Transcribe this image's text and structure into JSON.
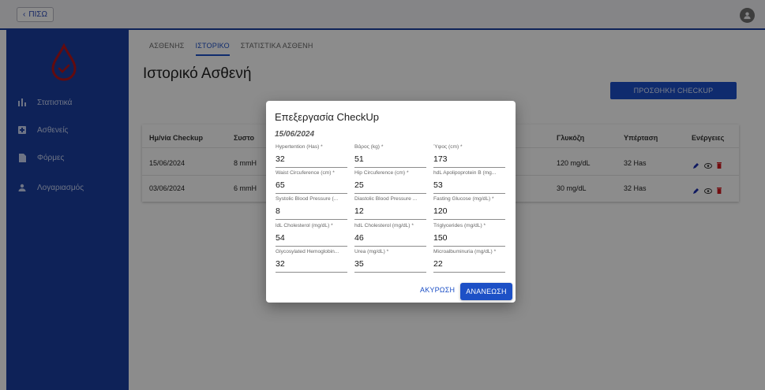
{
  "topbar": {
    "back_label": "ΠΙΣΩ"
  },
  "sidebar": {
    "items": [
      {
        "label": "Στατιστικά",
        "icon": "bar-chart-icon"
      },
      {
        "label": "Ασθενείς",
        "icon": "plus-box-icon"
      },
      {
        "label": "Φόρμες",
        "icon": "document-icon"
      },
      {
        "label": "Λογαριασμός",
        "icon": "person-icon"
      }
    ]
  },
  "tabs": [
    {
      "label": "ΑΣΘΕΝΗΣ"
    },
    {
      "label": "ΙΣΤΟΡΙΚΟ",
      "active": true
    },
    {
      "label": "ΣΤΑΤΙΣΤΙΚΑ ΑΣΘΕΝΗ"
    }
  ],
  "page_title": "Ιστορικό Ασθενή",
  "add_checkup_label": "ΠΡΟΣΘΗΚΗ CHECKUP",
  "table": {
    "headers": [
      "Ημ/νία Checkup",
      "Συστο",
      "Γλυκόζη",
      "Υπέρταση",
      "Ενέργειες"
    ],
    "rows": [
      {
        "date": "15/06/2024",
        "sys": "8 mmH",
        "glucose": "120 mg/dL",
        "hyper": "32 Has"
      },
      {
        "date": "03/06/2024",
        "sys": "6 mmH",
        "glucose": "30 mg/dL",
        "hyper": "32 Has"
      }
    ]
  },
  "dialog": {
    "title": "Επεξεργασία CheckUp",
    "date": "15/06/2024",
    "fields": [
      {
        "label": "Hypertention (Has) *",
        "value": "32"
      },
      {
        "label": "Βάρος (kg) *",
        "value": "51"
      },
      {
        "label": "Ύψος (cm) *",
        "value": "173"
      },
      {
        "label": "Waist Circuference (cm) *",
        "value": "65"
      },
      {
        "label": "Hip Circuference (cm) *",
        "value": "25"
      },
      {
        "label": "hdL Apolipoprotein B (mg...",
        "value": "53"
      },
      {
        "label": "Systolic Blood Pressure (...",
        "value": "8"
      },
      {
        "label": "Diastolic Blood Pressure ...",
        "value": "12"
      },
      {
        "label": "Fasting Glucose (mg/dL) *",
        "value": "120"
      },
      {
        "label": "ldL Cholesterol (mg/dL) *",
        "value": "54"
      },
      {
        "label": "hdL Cholesterol (mg/dL) *",
        "value": "46"
      },
      {
        "label": "Triglycerides (mg/dL) *",
        "value": "150"
      },
      {
        "label": "Glycosylated Hemoglobin...",
        "value": "32"
      },
      {
        "label": "Urea (mg/dL) *",
        "value": "35"
      },
      {
        "label": "Microalbuminuria (mg/dL) *",
        "value": "22"
      }
    ],
    "cancel_label": "ΑΚΥΡΩΣΗ",
    "update_label": "ΑΝΑΝΕΩΣΗ"
  },
  "colors": {
    "primary": "#1a3fa0",
    "accent": "#1d50c6",
    "logo": "#b3151d",
    "delete": "#d0161c"
  }
}
